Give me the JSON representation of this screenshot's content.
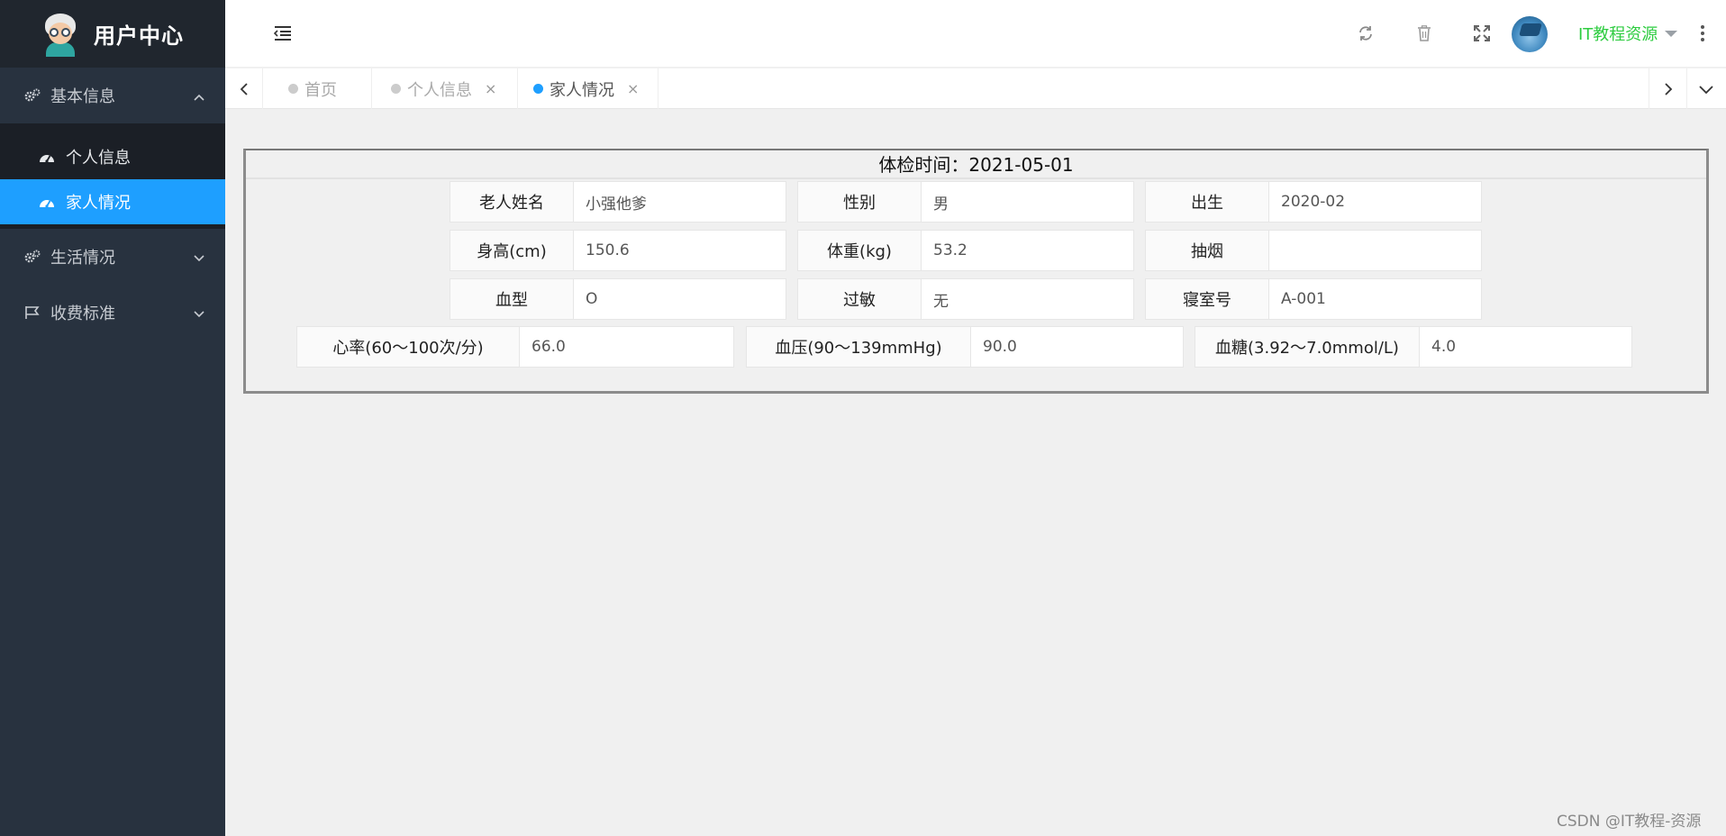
{
  "sidebar": {
    "logo_title": "用户中心",
    "groups": [
      {
        "label": "基本信息",
        "icon": "gears-icon",
        "expanded": true,
        "items": [
          {
            "label": "个人信息",
            "icon": "dashboard-icon"
          },
          {
            "label": "家人情况",
            "icon": "dashboard-icon",
            "active": true
          }
        ]
      },
      {
        "label": "生活情况",
        "icon": "gears-icon",
        "expanded": false
      },
      {
        "label": "收费标准",
        "icon": "flag-icon",
        "expanded": false
      }
    ]
  },
  "header": {
    "icons": [
      "menu-icon",
      "refresh-icon",
      "trash-icon",
      "fullscreen-icon",
      "more-vertical-icon"
    ],
    "user_name": "IT教程资源"
  },
  "tabs": [
    {
      "label": "首页",
      "active": false
    },
    {
      "label": "个人信息",
      "active": false,
      "close": "×"
    },
    {
      "label": "家人情况",
      "active": true,
      "close": "×"
    }
  ],
  "report": {
    "title_label": "体检时间：",
    "title_value": "2021-05-01",
    "rows": [
      [
        {
          "label": "老人姓名",
          "value": "小强他爹"
        },
        {
          "label": "性别",
          "value": "男"
        },
        {
          "label": "出生",
          "value": "2020-02"
        }
      ],
      [
        {
          "label": "身高(cm)",
          "value": "150.6"
        },
        {
          "label": "体重(kg)",
          "value": "53.2"
        },
        {
          "label": "抽烟",
          "value": ""
        }
      ],
      [
        {
          "label": "血型",
          "value": "O"
        },
        {
          "label": "过敏",
          "value": "无"
        },
        {
          "label": "寝室号",
          "value": "A-001"
        }
      ],
      [
        {
          "label": "心率(60～100次/分)",
          "value": "66.0"
        },
        {
          "label": "血压(90～139mmHg)",
          "value": "90.0"
        },
        {
          "label": "血糖(3.92～7.0mmol/L)",
          "value": "4.0"
        }
      ]
    ]
  },
  "colors": {
    "accent": "#1e9fff",
    "sidebar_bg": "#28323f",
    "user_name": "#2ecc40"
  },
  "watermark": "CSDN @IT教程-资源"
}
